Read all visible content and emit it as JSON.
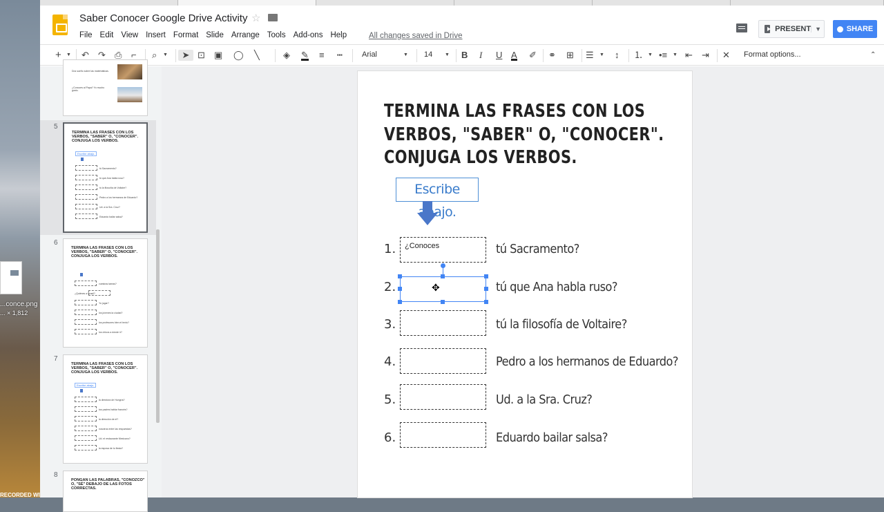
{
  "desktop": {
    "file_label": "...conce.png",
    "file_size": "... × 1,812",
    "recorder_label": "RECORDED WITH"
  },
  "header": {
    "doc_title": "Saber Conocer Google Drive Activity",
    "saved_status": "All changes saved in Drive",
    "present_label": "PRESENT",
    "share_label": "SHARE"
  },
  "menu": [
    "File",
    "Edit",
    "View",
    "Insert",
    "Format",
    "Slide",
    "Arrange",
    "Tools",
    "Add-ons",
    "Help"
  ],
  "toolbar": {
    "font_name": "Arial",
    "font_size": "14",
    "format_options": "Format options..."
  },
  "filmstrip": {
    "slide4_rows": [
      "Dos sueño sobre las matemáticas.",
      "¿Conoces al Papa? Yo mucho gusto."
    ],
    "slides": [
      {
        "num": "5",
        "title": "TERMINA LAS FRASES CON LOS VERBOS, \"SABER\" O, \"CONOCER\". CONJUGA LOS VERBOS.",
        "box": "Escribe abajo.",
        "rows": [
          "tú Sacramento?",
          "tú que Ana habla ruso?",
          "tú la filosofía de Voltaire?",
          "Pedro a los hermanos de Eduardo?",
          "Ud. a la Sra. Cruz?",
          "Eduardo bailar salsa?"
        ]
      },
      {
        "num": "6",
        "title": "TERMINA LAS FRASES CON LOS VERBOS, \"SABER\" O, \"CONOCER\". CONJUGA LOS VERBOS.",
        "box": "",
        "rows": [
          "vuestras tareas?",
          "¿Quiénes a Brasil?",
          "Yo jugar?",
          "los jóvenes la ciudad?",
          "los profesores bien el texto?",
          "los chicos a dónde ir?"
        ]
      },
      {
        "num": "7",
        "title": "TERMINA LAS FRASES CON LOS VERBOS, \"SABER\" O, \"CONOCER\". CONJUGA LOS VERBOS.",
        "box": "Escribe abajo.",
        "rows": [
          "la directora de Hungría?",
          "tus padres hablar francés?",
          "la dirección de el?",
          "nosotros entre las respuestas?",
          "Ud. el restaurante Mexicano?",
          "la esposa de tu fiesta?"
        ]
      },
      {
        "num": "8",
        "title": "PONGAN LAS PALABRAS, \"CONOZCO\" O, \"SÉ\" DEBAJO DE LAS FOTOS CORRECTAS.",
        "box": "",
        "rows": []
      }
    ]
  },
  "slide": {
    "title_lines": [
      "TERMINA LAS FRASES CON LOS",
      "VERBOS, \"SABER\" O, \"CONOCER\".",
      "CONJUGA LOS VERBOS."
    ],
    "instruction": "Escribe abajo.",
    "items": [
      {
        "num": "1.",
        "answer": "¿Conoces",
        "sentence": "tú Sacramento?"
      },
      {
        "num": "2.",
        "answer": "",
        "sentence": "tú que Ana habla ruso?"
      },
      {
        "num": "3.",
        "answer": "",
        "sentence": "tú la filosofía de Voltaire?"
      },
      {
        "num": "4.",
        "answer": "",
        "sentence": "Pedro a los hermanos de Eduardo?"
      },
      {
        "num": "5.",
        "answer": "",
        "sentence": "Ud. a la Sra. Cruz?"
      },
      {
        "num": "6.",
        "answer": "",
        "sentence": "Eduardo bailar salsa?"
      }
    ]
  },
  "colors": {
    "accent": "#4285f4",
    "logo": "#f4b400",
    "title_text": "#222222",
    "arrow": "#4a77c9"
  }
}
